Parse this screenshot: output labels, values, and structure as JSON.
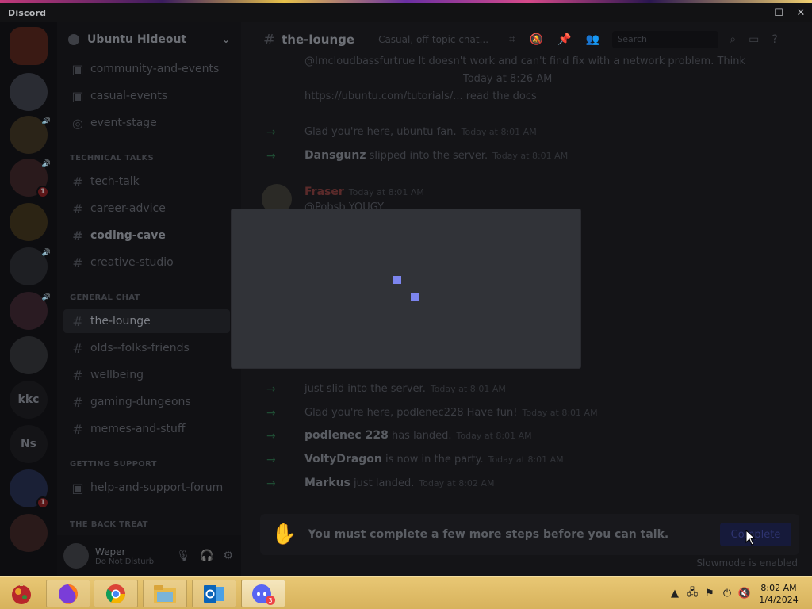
{
  "window": {
    "title": "Discord",
    "controls": {
      "minimize": "—",
      "maximize": "☐",
      "close": "✕"
    }
  },
  "servers": [
    {
      "name": "kkc",
      "label": "kkc"
    },
    {
      "name": "Ns",
      "label": "Ns"
    }
  ],
  "server_badges": {
    "third": "1",
    "nineteenth": "1"
  },
  "guild": {
    "name": "Ubuntu Hideout"
  },
  "channels": {
    "top": [
      {
        "label": "community-and-events"
      },
      {
        "label": "casual-events"
      },
      {
        "label": "event-stage"
      }
    ],
    "technical_category": "TECHNICAL TALKS",
    "technical": [
      {
        "label": "tech-talk"
      },
      {
        "label": "career-advice"
      },
      {
        "label": "coding-cave"
      },
      {
        "label": "creative-studio"
      }
    ],
    "general_category": "GENERAL CHAT",
    "general": [
      {
        "label": "the-lounge"
      },
      {
        "label": "olds--folks-friends"
      },
      {
        "label": "wellbeing"
      },
      {
        "label": "gaming-dungeons"
      },
      {
        "label": "memes-and-stuff"
      }
    ],
    "support_category": "GETTING SUPPORT",
    "support": [
      {
        "label": "help-and-support-forum"
      }
    ],
    "bottom_category": "THE BACK TREAT"
  },
  "user": {
    "name": "Weper",
    "status": "Do Not Disturb"
  },
  "channel_header": {
    "name": "the-lounge",
    "topic": "Casual, off-topic chat...",
    "search_placeholder": "Search"
  },
  "messages": [
    {
      "who": "",
      "text": "@Imcloudbassfurtrue It doesn't work and can't find fix with a network problem. Think",
      "meta": ""
    },
    {
      "who": "",
      "text": "Today at 8:26 AM",
      "meta": ""
    },
    {
      "who": "",
      "text": "https://ubuntu.com/tutorials/... read the docs",
      "meta": ""
    },
    {
      "who": "",
      "text": "Glad you're here, ubuntu fan.",
      "meta": "Today at 8:01 AM"
    },
    {
      "who": "Dansgunz",
      "text": "slipped into the server.",
      "meta": "Today at 8:01 AM"
    },
    {
      "who": "Fraser",
      "text": "@Pobsb YOUGY",
      "meta": "Today at 8:01 AM"
    },
    {
      "who": "",
      "text": "just slid into the server.",
      "meta": "Today at 8:01 AM"
    },
    {
      "who": "",
      "text": "Glad you're here, podlenec228 Have fun!",
      "meta": "Today at 8:01 AM"
    },
    {
      "who": "podlenec 228",
      "text": "has landed.",
      "meta": "Today at 8:01 AM"
    },
    {
      "who": "VoltyDragon",
      "text": "is now in the party.",
      "meta": "Today at 8:01 AM"
    },
    {
      "who": "Markus",
      "text": "just landed.",
      "meta": "Today at 8:02 AM"
    }
  ],
  "gate": {
    "text": "You must complete a few more steps before you can talk.",
    "button": "Complete",
    "slowmode": "Slowmode is enabled"
  },
  "taskbar": {
    "discord_badge": "3",
    "time": "8:02 AM",
    "date": "1/4/2024"
  },
  "colors": {
    "spinner": "#7c85ee",
    "modal_bg": "#313338",
    "taskbar": "#d7b25c"
  }
}
